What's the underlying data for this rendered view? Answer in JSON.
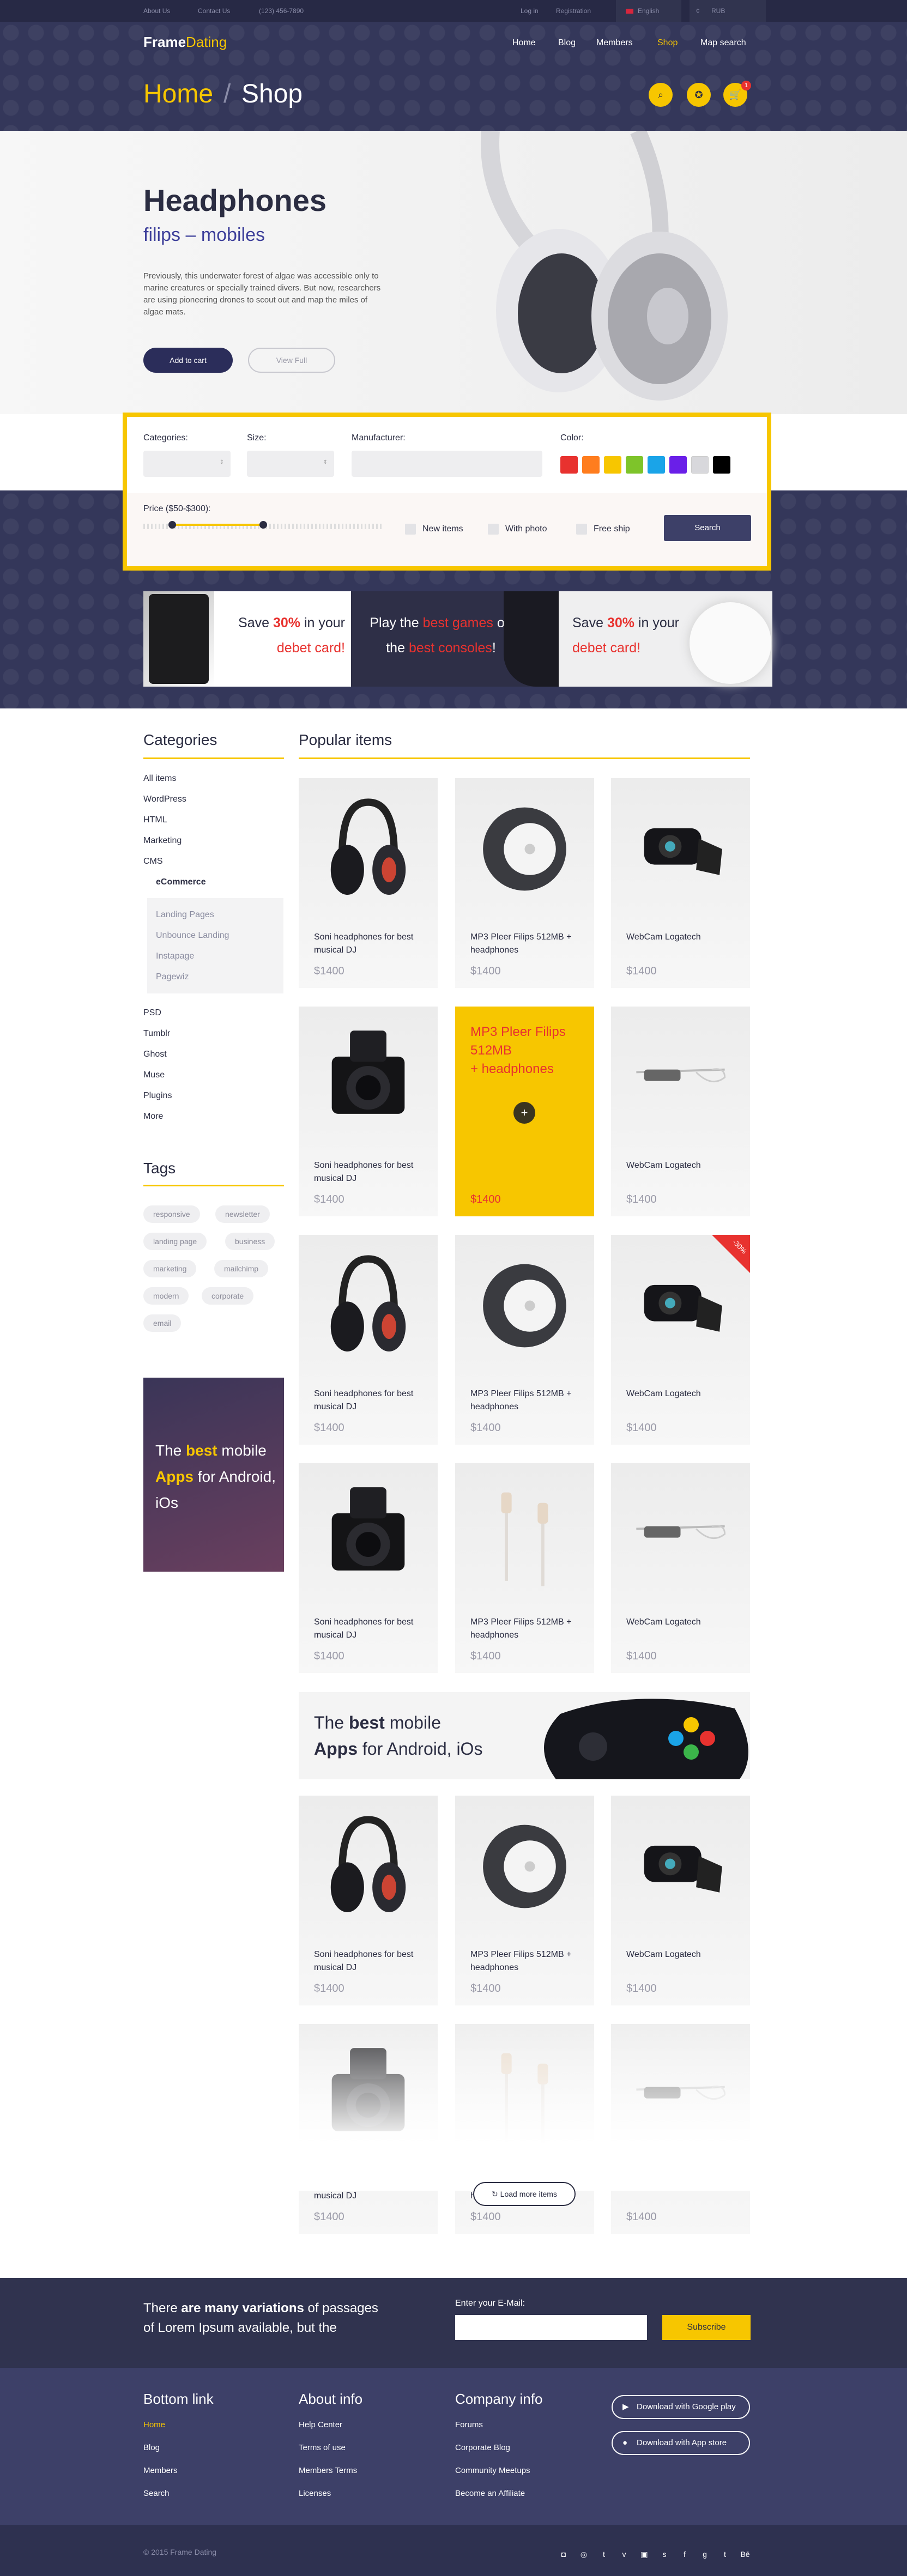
{
  "topbar": {
    "about": "About Us",
    "contact": "Contact Us",
    "phone": "(123) 456-7890",
    "login": "Log in",
    "registration": "Registration",
    "language": "English",
    "currency": "RUB"
  },
  "logo": {
    "part1": "Frame",
    "part2": "Dating"
  },
  "nav": {
    "items": [
      "Home",
      "Blog",
      "Members",
      "Shop",
      "Map search"
    ],
    "active": "Shop"
  },
  "breadcrumb": {
    "home": "Home",
    "separator": "/",
    "current": "Shop"
  },
  "header_icons": [
    "search-icon",
    "compass-icon",
    "cart-icon"
  ],
  "cart_count": "1",
  "hero": {
    "title": "Headphones",
    "subtitle": "filips – mobiles",
    "description": "Previously, this underwater forest of algae was accessible only to marine creatures or specially trained divers. But now, researchers are using pioneering drones to scout out and map the miles of algae mats.",
    "add_to_cart": "Add to cart",
    "view_full": "View Full"
  },
  "filter": {
    "categories_label": "Categories:",
    "size_label": "Size:",
    "manufacturer_label": "Manufacturer:",
    "color_label": "Color:",
    "price_label": "Price ($50-$300):",
    "price_range": [
      0.12,
      0.5
    ],
    "checkbox_new": "New items",
    "checkbox_photo": "With photo",
    "checkbox_ship": "Free ship",
    "search_button": "Search",
    "colors": [
      "#e8322f",
      "#ff7d1e",
      "#f7c600",
      "#7ec42a",
      "#1aa4e8",
      "#6a1fe8",
      "#d8d8dc",
      "#000000"
    ]
  },
  "promos": [
    {
      "pre": "Save ",
      "hl": "30%",
      "post": " in your",
      "line2": "debet card!"
    },
    {
      "pre": "Play the ",
      "hl": "best games",
      "post": " on",
      "line2pre": "the ",
      "line2hl": "best consoles",
      "line2post": "!"
    },
    {
      "pre": "Save ",
      "hl": "30%",
      "post": " in your",
      "line2": "debet card!"
    }
  ],
  "sidebar": {
    "categories_title": "Categories",
    "categories": [
      "All items",
      "WordPress",
      "HTML",
      "Marketing",
      "CMS"
    ],
    "cms_child": "eCommerce",
    "ecommerce_children": [
      "Landing Pages",
      "Unbounce Landing",
      "Instapage",
      "Pagewiz"
    ],
    "categories_more": [
      "PSD",
      "Tumblr",
      "Ghost",
      "Muse",
      "Plugins",
      "More"
    ],
    "tags_title": "Tags",
    "tags": [
      "responsive",
      "newsletter",
      "landing page",
      "business",
      "marketing",
      "mailchimp",
      "modern",
      "corporate",
      "email"
    ],
    "ad": {
      "pre": "The ",
      "hl": "best",
      "mid": " mobile",
      "hl2": "Apps",
      "post": " for Android,",
      "end": "iOs"
    }
  },
  "popular": {
    "title": "Popular items",
    "price": "$1400",
    "names": {
      "headphones": "Soni headphones for best musical DJ",
      "mp3": "MP3 Pleer Filips 512MB + headphones",
      "webcam": "WebCam Logatech"
    },
    "highlight": {
      "line1": "MP3 Pleer Filips",
      "line2": "512MB",
      "line3": "+ headphones"
    },
    "sale_badge": "-30%"
  },
  "banner": {
    "pre": "The ",
    "hl": "best",
    "post": " mobile",
    "line2hl": "Apps",
    "line2post": " for Android, iOs"
  },
  "load_more": "Load more items",
  "subscribe": {
    "text_pre": "There ",
    "text_hl": "are many variations",
    "text_post": " of passages",
    "text_line2": "of Lorem Ipsum available, but the",
    "email_label": "Enter your E-Mail:",
    "button": "Subscribe"
  },
  "footer": {
    "bottom_title": "Bottom link",
    "bottom_links": [
      "Home",
      "Blog",
      "Members",
      "Search"
    ],
    "about_title": "About info",
    "about_links": [
      "Help Center",
      "Terms of use",
      "Members Terms",
      "Licenses"
    ],
    "company_title": "Company info",
    "company_links": [
      "Forums",
      "Corporate Blog",
      "Community Meetups",
      "Become an Affiliate"
    ],
    "google_play": "Download with Google play",
    "app_store": "Download with App store",
    "copyright": "© 2015 Frame Dating"
  },
  "social": [
    "instagram-icon",
    "dribbble-icon",
    "twitter-icon",
    "vimeo-icon",
    "youtube-icon",
    "skype-icon",
    "facebook-icon",
    "google-plus-icon",
    "tumblr-icon",
    "behance-icon"
  ],
  "accent": "#f7c600",
  "dark": "#34375a",
  "red": "#e8322f"
}
